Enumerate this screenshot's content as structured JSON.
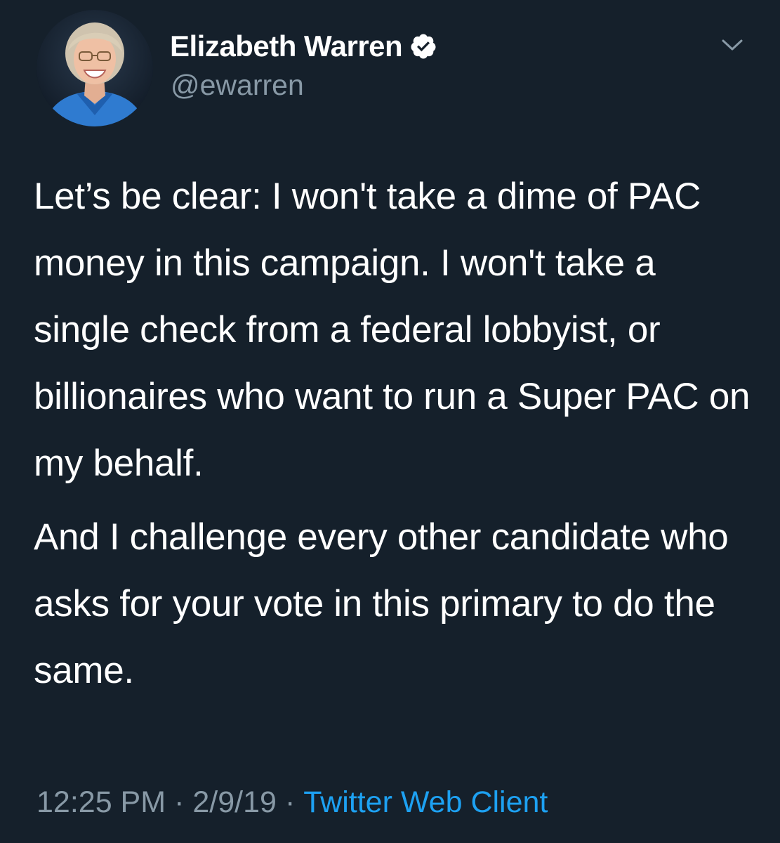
{
  "author": {
    "display_name": "Elizabeth Warren",
    "handle": "@ewarren",
    "verified": true
  },
  "icons": {
    "verified": "verified-badge-icon",
    "menu": "chevron-down-icon",
    "avatar": "profile-photo"
  },
  "tweet": {
    "paragraphs": [
      "Let’s be clear: I won't take a dime of PAC money in this campaign. I won't take a single check from a federal lobbyist, or billionaires who want to run a Super PAC on my behalf.",
      "And I challenge every other candidate who asks for your vote in this primary to do the same."
    ]
  },
  "meta": {
    "time": "12:25 PM",
    "date": "2/9/19",
    "separator": "·",
    "client": "Twitter Web Client"
  },
  "colors": {
    "background": "#15202b",
    "text": "#ffffff",
    "secondary_text": "#8899a6",
    "accent": "#1da1f2"
  }
}
